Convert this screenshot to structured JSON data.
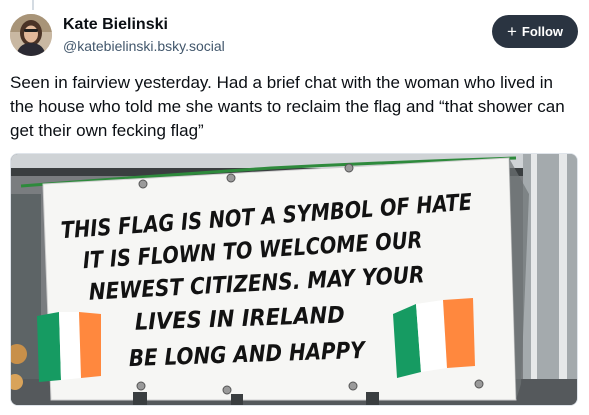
{
  "author": {
    "display_name": "Kate Bielinski",
    "handle": "@katebielinski.bsky.social"
  },
  "follow_button": {
    "icon": "plus-icon",
    "label": "Follow"
  },
  "post": {
    "text": "Seen in fairview yesterday. Had a brief chat with the woman who lived in the house who told me she wants to reclaim the flag and “that shower can get their own fecking flag”"
  },
  "image": {
    "banner_lines": [
      "THIS FLAG IS NOT A SYMBOL OF HATE",
      "IT IS FLOWN TO WELCOME OUR",
      "NEWEST CITIZENS. MAY YOUR",
      "LIVES IN IRELAND",
      "BE LONG AND HAPPY"
    ],
    "flag_colors": [
      "#169b62",
      "#ffffff",
      "#ff883e"
    ]
  }
}
